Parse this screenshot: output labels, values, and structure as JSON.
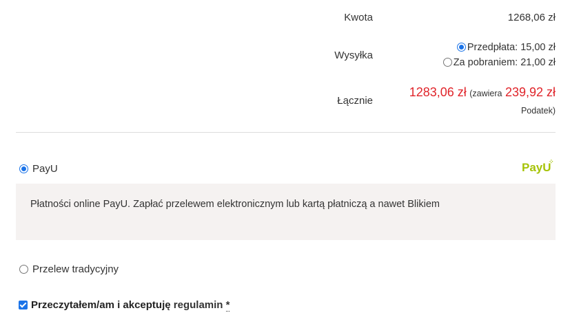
{
  "summary": {
    "amount_label": "Kwota",
    "amount_value": "1268,06 zł",
    "shipping_label": "Wysyłka",
    "shipping_options": [
      {
        "label": "Przedpłata: 15,00 zł",
        "selected": true
      },
      {
        "label": "Za pobraniem: 21,00 zł",
        "selected": false
      }
    ],
    "total_label": "Łącznie",
    "total_value": "1283,06 zł",
    "tax_prefix": "(zawiera",
    "tax_value": "239,92 zł",
    "tax_suffix": "Podatek)"
  },
  "payment": {
    "payu_label": "PayU",
    "payu_selected": true,
    "payu_logo_text": "PayU",
    "payu_description": "Płatności online PayU. Zapłać przelewem elektronicznym lub kartą płatniczą a nawet Blikiem",
    "transfer_label": "Przelew tradycyjny",
    "transfer_selected": false
  },
  "terms": {
    "text": "Przeczytałem/am i akceptuję",
    "link": "regulamin",
    "required_mark": "*",
    "checked": true
  },
  "colors": {
    "accent": "#1a73e8",
    "price_red": "#e0242a",
    "payu_green": "#a6c307",
    "box_bg": "#f5f2f1"
  }
}
